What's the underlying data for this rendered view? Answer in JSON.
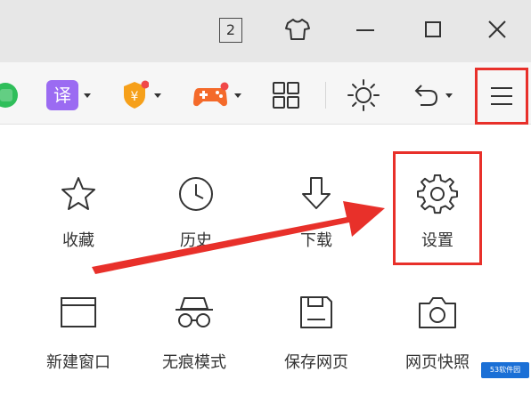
{
  "titlebar": {
    "tab_count": "2",
    "icons": [
      "skin-icon",
      "minimize-icon",
      "maximize-icon",
      "close-icon"
    ]
  },
  "toolbar": {
    "translate_label": "译",
    "items": [
      "green-app-icon",
      "translate-icon",
      "shield-icon",
      "game-icon",
      "apps-grid-icon",
      "brightness-icon",
      "undo-icon",
      "hamburger-menu-icon"
    ]
  },
  "menu": {
    "row1": [
      {
        "label": "收藏",
        "icon": "star-icon"
      },
      {
        "label": "历史",
        "icon": "clock-icon"
      },
      {
        "label": "下载",
        "icon": "download-icon"
      },
      {
        "label": "设置",
        "icon": "gear-icon"
      }
    ],
    "row2": [
      {
        "label": "新建窗口",
        "icon": "new-window-icon"
      },
      {
        "label": "无痕模式",
        "icon": "incognito-icon"
      },
      {
        "label": "保存网页",
        "icon": "save-page-icon"
      },
      {
        "label": "网页快照",
        "icon": "camera-icon"
      }
    ]
  },
  "annotation": {
    "highlight_color": "#e8302a"
  },
  "watermark": {
    "text": "53软件园"
  }
}
